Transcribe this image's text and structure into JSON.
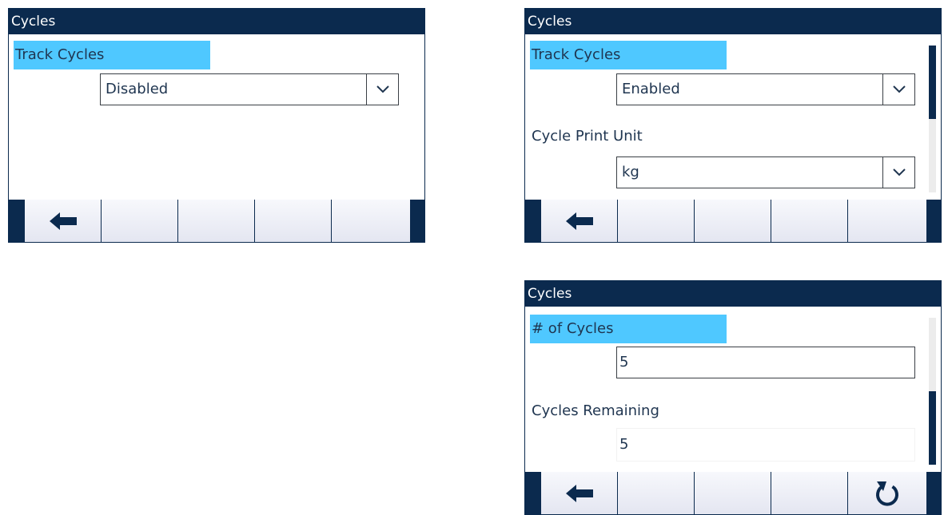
{
  "screens": [
    {
      "title": "Cycles",
      "fields": [
        {
          "label": "Track Cycles",
          "value": "Disabled"
        }
      ]
    },
    {
      "title": "Cycles",
      "fields": [
        {
          "label": "Track Cycles",
          "value": "Enabled"
        },
        {
          "label": "Cycle Print Unit",
          "value": "kg"
        }
      ]
    },
    {
      "title": "Cycles",
      "fields": [
        {
          "label": "# of Cycles",
          "value": "5"
        },
        {
          "label": "Cycles Remaining",
          "value": "5"
        }
      ]
    }
  ],
  "softkeys": {
    "exit_icon": "left-arrow-icon",
    "reset_icon": "circular-arrow-icon"
  },
  "colors": {
    "title_bar": "#0b2a4e",
    "highlight": "#4fc8ff",
    "text": "#1f3550"
  }
}
